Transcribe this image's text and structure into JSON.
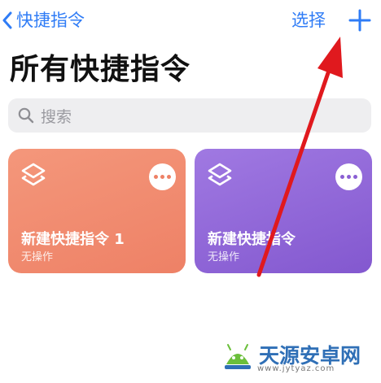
{
  "nav": {
    "back_label": "快捷指令",
    "select_label": "选择",
    "add_icon": "plus-icon"
  },
  "page": {
    "title": "所有快捷指令"
  },
  "search": {
    "placeholder": "搜索",
    "icon": "search-icon"
  },
  "cards": [
    {
      "name": "新建快捷指令 1",
      "subtitle": "无操作",
      "color": "#ef8468",
      "icon": "shortcuts-layers-icon"
    },
    {
      "name": "新建快捷指令",
      "subtitle": "无操作",
      "color": "#8b5fd2",
      "icon": "shortcuts-layers-icon"
    }
  ],
  "colors": {
    "accent": "#2f7cf6",
    "annotation_arrow": "#e0191e"
  },
  "watermark": {
    "text": "天源安卓网",
    "url": "www.jytyaz.com"
  }
}
